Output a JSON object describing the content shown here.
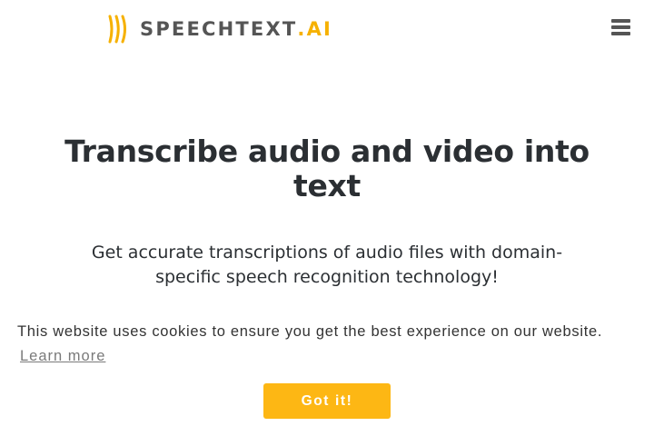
{
  "brand": {
    "name_main": "SPEECHTEXT",
    "name_accent": ".AI",
    "logo_icon": "sound-waves-icon",
    "accent_color": "#f6b100"
  },
  "header": {
    "menu_icon": "hamburger-menu-icon"
  },
  "hero": {
    "title": "Transcribe audio and video into text",
    "subtitle": "Get accurate transcriptions of audio files with domain-specific speech recognition technology!"
  },
  "cookie_banner": {
    "message": "This website uses cookies to ensure you get the best experience on our website.",
    "learn_more": "Learn more",
    "accept_label": "Got it!",
    "button_color": "#fdb714"
  }
}
